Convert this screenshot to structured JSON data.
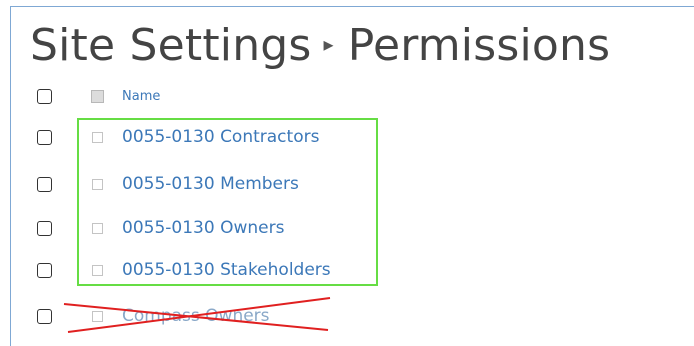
{
  "header": {
    "title_part1": "Site Settings",
    "separator": "▸",
    "title_part2": "Permissions"
  },
  "table": {
    "column_header": "Name",
    "rows": [
      {
        "label": "0055-0130 Contractors",
        "highlighted": true,
        "struck_out": false
      },
      {
        "label": "0055-0130 Members",
        "highlighted": true,
        "struck_out": false
      },
      {
        "label": "0055-0130 Owners",
        "highlighted": true,
        "struck_out": false
      },
      {
        "label": "0055-0130 Stakeholders",
        "highlighted": true,
        "struck_out": false
      },
      {
        "label": "Compass Owners",
        "highlighted": false,
        "struck_out": true
      }
    ]
  },
  "annotations": {
    "highlight_color": "#66dd44",
    "strike_color": "#e02020"
  }
}
